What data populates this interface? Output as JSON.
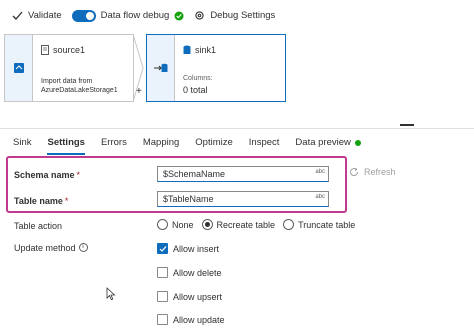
{
  "toolbar": {
    "validate_label": "Validate",
    "debug_label": "Data flow debug",
    "debug_settings_label": "Debug Settings",
    "debug_on": true
  },
  "canvas": {
    "source": {
      "title": "source1",
      "desc_line1": "Import data from",
      "desc_line2": "AzureDataLakeStorage1"
    },
    "sink": {
      "title": "sink1",
      "columns_label": "Columns:",
      "columns_value": "0 total"
    },
    "plus": "+"
  },
  "tabs": [
    {
      "label": "Sink"
    },
    {
      "label": "Settings"
    },
    {
      "label": "Errors"
    },
    {
      "label": "Mapping"
    },
    {
      "label": "Optimize"
    },
    {
      "label": "Inspect"
    },
    {
      "label": "Data preview"
    }
  ],
  "active_tab": "Settings",
  "form": {
    "schema_name_label": "Schema name",
    "schema_name_value": "$SchemaName",
    "table_name_label": "Table name",
    "table_name_value": "$TableName",
    "required_mark": "*",
    "abc_hint": "abc",
    "refresh_label": "Refresh",
    "table_action_label": "Table action",
    "table_action_options": [
      "None",
      "Recreate table",
      "Truncate table"
    ],
    "table_action_selected": "Recreate table",
    "update_method_label": "Update method",
    "update_methods": [
      {
        "label": "Allow insert",
        "checked": true
      },
      {
        "label": "Allow delete",
        "checked": false
      },
      {
        "label": "Allow upsert",
        "checked": false
      },
      {
        "label": "Allow update",
        "checked": false
      }
    ]
  },
  "colors": {
    "accent": "#0f6cbd",
    "highlight": "#c03a8e",
    "status_green": "#13a10e"
  }
}
